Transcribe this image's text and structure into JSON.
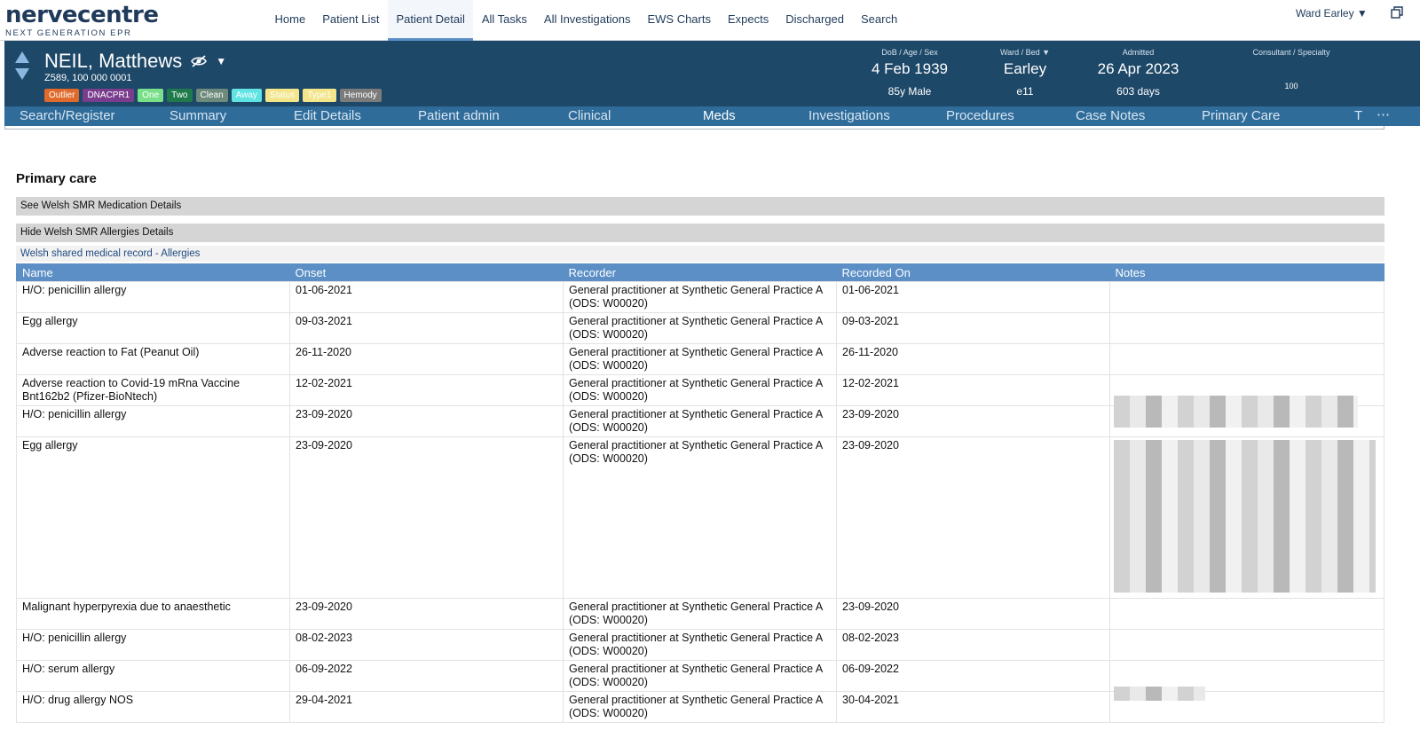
{
  "brand": {
    "name": "nervecentre",
    "tagline": "NEXT GENERATION EPR"
  },
  "top_nav": {
    "items": [
      {
        "label": "Home",
        "active": false
      },
      {
        "label": "Patient List",
        "active": false
      },
      {
        "label": "Patient Detail",
        "active": true
      },
      {
        "label": "All Tasks",
        "active": false
      },
      {
        "label": "All Investigations",
        "active": false
      },
      {
        "label": "EWS Charts",
        "active": false
      },
      {
        "label": "Expects",
        "active": false
      },
      {
        "label": "Discharged",
        "active": false
      },
      {
        "label": "Search",
        "active": false
      }
    ],
    "ward_selector": "Ward Earley ▼"
  },
  "patient": {
    "name": "NEIL, Matthews",
    "ids": "Z589, 100 000 0001",
    "badges": [
      {
        "label": "Outlier",
        "color": "#e06a2c"
      },
      {
        "label": "DNACPR1",
        "color": "#7a3d8e"
      },
      {
        "label": "One",
        "color": "#79e08a"
      },
      {
        "label": "Two",
        "color": "#1e7a4a"
      },
      {
        "label": "Clean",
        "color": "#6e8a7a"
      },
      {
        "label": "Away",
        "color": "#5fe3e3"
      },
      {
        "label": "Status",
        "color": "#f3e58a"
      },
      {
        "label": "Type1",
        "color": "#f3e58a"
      },
      {
        "label": "Hemody",
        "color": "#7b7b7b"
      }
    ],
    "dob_label": "DoB / Age / Sex",
    "dob": "4 Feb 1939",
    "age_sex": "85y Male",
    "ward_label": "Ward / Bed",
    "ward": "Earley",
    "bed": "e11",
    "admitted_label": "Admitted",
    "admitted": "26 Apr 2023",
    "admitted_days": "603 days",
    "consultant_label": "Consultant / Specialty",
    "consultant_value": "100"
  },
  "sub_nav": {
    "items": [
      {
        "label": "Search/Register",
        "active": false
      },
      {
        "label": "Summary",
        "active": false
      },
      {
        "label": "Edit Details",
        "active": false
      },
      {
        "label": "Patient admin",
        "active": false
      },
      {
        "label": "Clinical",
        "active": false
      },
      {
        "label": "Meds",
        "active": true
      },
      {
        "label": "Investigations",
        "active": false
      },
      {
        "label": "Procedures",
        "active": false
      },
      {
        "label": "Case Notes",
        "active": false
      },
      {
        "label": "Primary Care",
        "active": false
      },
      {
        "label": "T",
        "active": false
      }
    ],
    "more": "⋯"
  },
  "content": {
    "title": "Primary care",
    "toggle_meds": "See Welsh SMR Medication Details",
    "toggle_allergies": "Hide Welsh SMR Allergies Details",
    "smr_label": "Welsh shared medical record - Allergies"
  },
  "allergy_table": {
    "headers": [
      "Name",
      "Onset",
      "Recorder",
      "Recorded On",
      "Notes"
    ],
    "rows": [
      [
        "H/O: penicillin allergy",
        "01-06-2021",
        "General practitioner at Synthetic General Practice A (ODS: W00020)",
        "01-06-2021",
        ""
      ],
      [
        "Egg allergy",
        "09-03-2021",
        "General practitioner at Synthetic General Practice A (ODS: W00020)",
        "09-03-2021",
        ""
      ],
      [
        "Adverse reaction to Fat (Peanut Oil)",
        "26-11-2020",
        "General practitioner at Synthetic General Practice A (ODS: W00020)",
        "26-11-2020",
        ""
      ],
      [
        "Adverse reaction to Covid-19 mRna Vaccine Bnt162b2 (Pfizer-BioNtech)",
        "12-02-2021",
        "General practitioner at Synthetic General Practice A (ODS: W00020)",
        "12-02-2021",
        ""
      ],
      [
        "H/O: penicillin allergy",
        "23-09-2020",
        "General practitioner at Synthetic General Practice A (ODS: W00020)",
        "23-09-2020",
        ""
      ],
      [
        "Egg allergy",
        "23-09-2020",
        "General practitioner at Synthetic General Practice A (ODS: W00020)",
        "23-09-2020",
        ""
      ],
      [
        "Malignant hyperpyrexia due to anaesthetic",
        "23-09-2020",
        "General practitioner at Synthetic General Practice A (ODS: W00020)",
        "23-09-2020",
        ""
      ],
      [
        "H/O: penicillin allergy",
        "08-02-2023",
        "General practitioner at Synthetic General Practice A (ODS: W00020)",
        "08-02-2023",
        ""
      ],
      [
        "H/O: serum allergy",
        "06-09-2022",
        "General practitioner at Synthetic General Practice A (ODS: W00020)",
        "06-09-2022",
        ""
      ],
      [
        "H/O: drug allergy NOS",
        "29-04-2021",
        "General practitioner at Synthetic General Practice A (ODS: W00020)",
        "30-04-2021",
        ""
      ]
    ]
  }
}
